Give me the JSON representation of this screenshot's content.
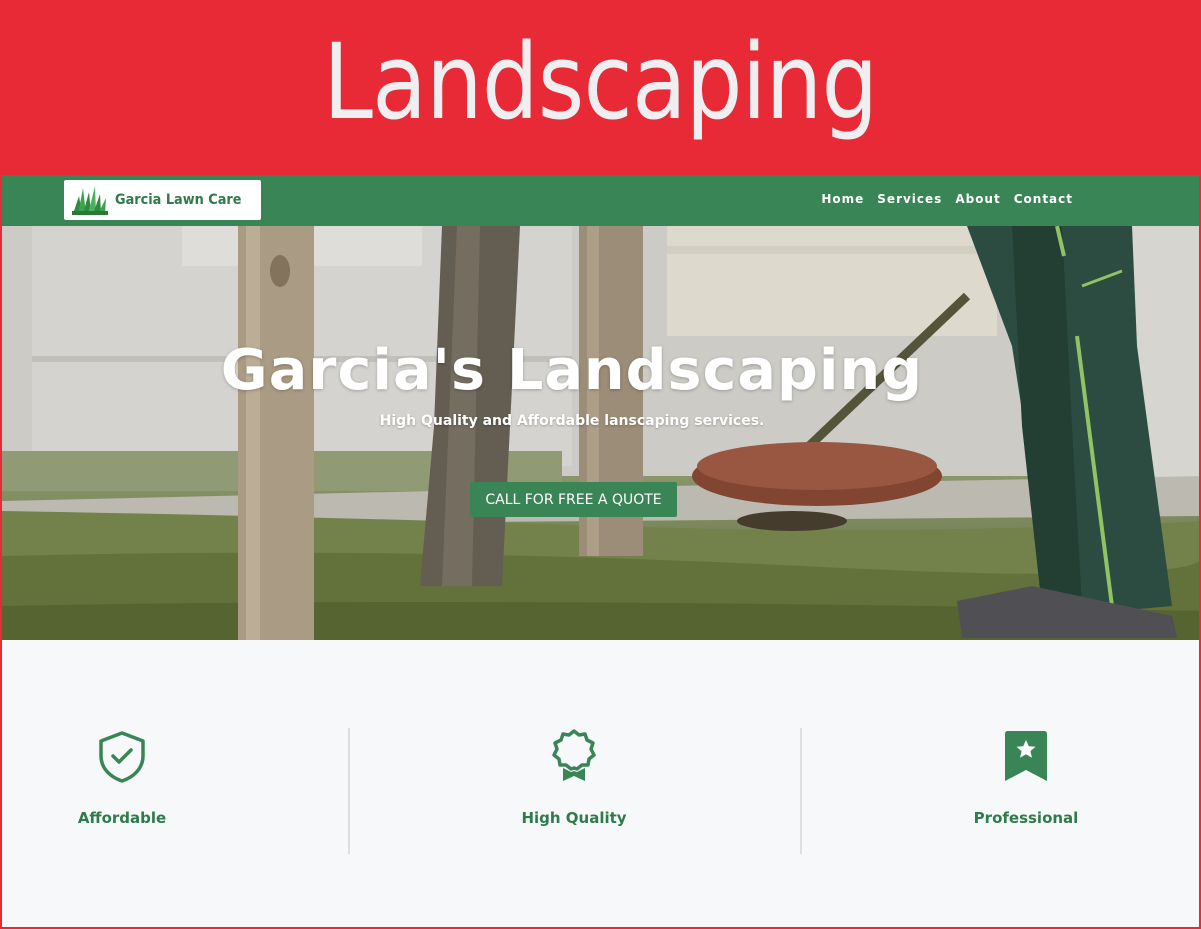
{
  "banner": {
    "title": "Landscaping"
  },
  "navbar": {
    "brand_name": "Garcia Lawn Care",
    "links": [
      "Home",
      "Services",
      "About",
      "Contact"
    ]
  },
  "hero": {
    "title": "Garcia's Landscaping",
    "subtitle": "High Quality and Affordable lanscaping services.",
    "cta_label": "CALL FOR FREE A QUOTE"
  },
  "features": [
    {
      "label": "Affordable",
      "icon": "shield-check-icon"
    },
    {
      "label": "High Quality",
      "icon": "award-ribbon-icon"
    },
    {
      "label": "Professional",
      "icon": "bookmark-star-icon"
    }
  ],
  "colors": {
    "banner_red": "#e82a36",
    "brand_green": "#3a8556",
    "text_green": "#2f7b4b",
    "feature_bg": "#f7f8fa"
  }
}
